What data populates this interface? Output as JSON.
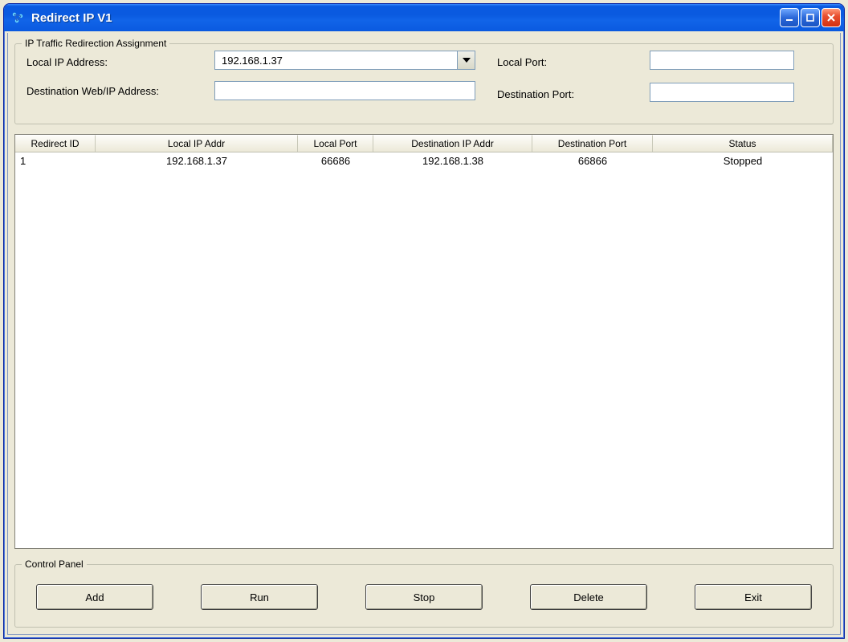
{
  "window": {
    "title": "Redirect IP V1"
  },
  "assignment": {
    "legend": "IP Traffic Redirection Assignment",
    "labels": {
      "local_ip": "Local IP Address:",
      "dest_ip": "Destination Web/IP Address:",
      "local_port": "Local Port:",
      "dest_port": "Destination Port:"
    },
    "values": {
      "local_ip": "192.168.1.37",
      "dest_ip": "",
      "local_port": "",
      "dest_port": ""
    }
  },
  "listview": {
    "columns": [
      "Redirect ID",
      "Local IP Addr",
      "Local Port",
      "Destination IP Addr",
      "Destination Port",
      "Status"
    ],
    "rows": [
      {
        "cells": [
          "1",
          "192.168.1.37",
          "66686",
          "192.168.1.38",
          "66866",
          "Stopped"
        ]
      }
    ]
  },
  "control": {
    "legend": "Control Panel",
    "buttons": {
      "add": "Add",
      "run": "Run",
      "stop": "Stop",
      "delete": "Delete",
      "exit": "Exit"
    }
  }
}
